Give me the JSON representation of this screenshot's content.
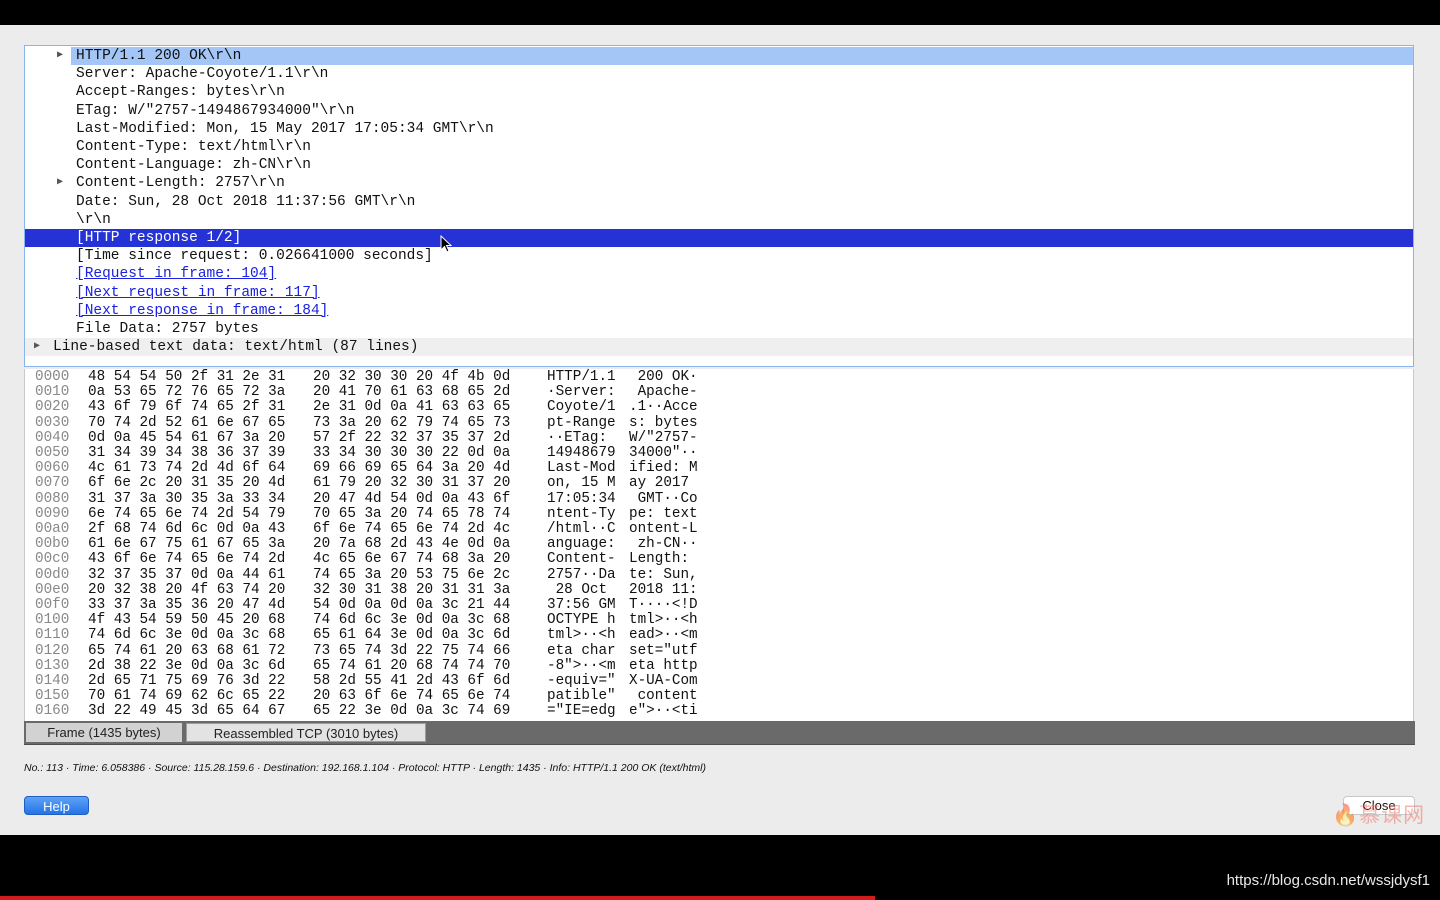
{
  "details": {
    "rows": [
      {
        "text": "HTTP/1.1 200 OK\\r\\n",
        "tri": "▶",
        "indent": 2,
        "state": "sel-light"
      },
      {
        "text": "Server: Apache-Coyote/1.1\\r\\n",
        "indent": 2
      },
      {
        "text": "Accept-Ranges: bytes\\r\\n",
        "indent": 2
      },
      {
        "text": "ETag: W/\"2757-1494867934000\"\\r\\n",
        "indent": 2
      },
      {
        "text": "Last-Modified: Mon, 15 May 2017 17:05:34 GMT\\r\\n",
        "indent": 2
      },
      {
        "text": "Content-Type: text/html\\r\\n",
        "indent": 2
      },
      {
        "text": "Content-Language: zh-CN\\r\\n",
        "indent": 2
      },
      {
        "text": "Content-Length: 2757\\r\\n",
        "tri": "▶",
        "indent": 2
      },
      {
        "text": "Date: Sun, 28 Oct 2018 11:37:56 GMT\\r\\n",
        "indent": 2
      },
      {
        "text": "\\r\\n",
        "indent": 2
      },
      {
        "text": "[HTTP response 1/2]",
        "indent": 2,
        "state": "sel-dark"
      },
      {
        "text": "[Time since request: 0.026641000 seconds]",
        "indent": 2
      },
      {
        "text": "[Request in frame: 104]",
        "indent": 2,
        "link": true
      },
      {
        "text": "[Next request in frame: 117]",
        "indent": 2,
        "link": true
      },
      {
        "text": "[Next response in frame: 184]",
        "indent": 2,
        "link": true
      },
      {
        "text": "File Data: 2757 bytes",
        "indent": 2
      },
      {
        "text": "Line-based text data: text/html (87 lines)",
        "tri": "▶",
        "indent": 1,
        "state": "last"
      }
    ]
  },
  "hex": {
    "rows": [
      {
        "off": "0000",
        "b1": "48 54 54 50 2f 31 2e 31",
        "b2": "20 32 30 30 20 4f 4b 0d",
        "a1": "HTTP/1.1",
        "a2": " 200 OK·"
      },
      {
        "off": "0010",
        "b1": "0a 53 65 72 76 65 72 3a",
        "b2": "20 41 70 61 63 68 65 2d",
        "a1": "·Server:",
        "a2": " Apache-"
      },
      {
        "off": "0020",
        "b1": "43 6f 79 6f 74 65 2f 31",
        "b2": "2e 31 0d 0a 41 63 63 65",
        "a1": "Coyote/1",
        "a2": ".1··Acce"
      },
      {
        "off": "0030",
        "b1": "70 74 2d 52 61 6e 67 65",
        "b2": "73 3a 20 62 79 74 65 73",
        "a1": "pt-Range",
        "a2": "s: bytes"
      },
      {
        "off": "0040",
        "b1": "0d 0a 45 54 61 67 3a 20",
        "b2": "57 2f 22 32 37 35 37 2d",
        "a1": "··ETag: ",
        "a2": "W/\"2757-"
      },
      {
        "off": "0050",
        "b1": "31 34 39 34 38 36 37 39",
        "b2": "33 34 30 30 30 22 0d 0a",
        "a1": "14948679",
        "a2": "34000\"··"
      },
      {
        "off": "0060",
        "b1": "4c 61 73 74 2d 4d 6f 64",
        "b2": "69 66 69 65 64 3a 20 4d",
        "a1": "Last-Mod",
        "a2": "ified: M"
      },
      {
        "off": "0070",
        "b1": "6f 6e 2c 20 31 35 20 4d",
        "b2": "61 79 20 32 30 31 37 20",
        "a1": "on, 15 M",
        "a2": "ay 2017 "
      },
      {
        "off": "0080",
        "b1": "31 37 3a 30 35 3a 33 34",
        "b2": "20 47 4d 54 0d 0a 43 6f",
        "a1": "17:05:34",
        "a2": " GMT··Co"
      },
      {
        "off": "0090",
        "b1": "6e 74 65 6e 74 2d 54 79",
        "b2": "70 65 3a 20 74 65 78 74",
        "a1": "ntent-Ty",
        "a2": "pe: text"
      },
      {
        "off": "00a0",
        "b1": "2f 68 74 6d 6c 0d 0a 43",
        "b2": "6f 6e 74 65 6e 74 2d 4c",
        "a1": "/html··C",
        "a2": "ontent-L"
      },
      {
        "off": "00b0",
        "b1": "61 6e 67 75 61 67 65 3a",
        "b2": "20 7a 68 2d 43 4e 0d 0a",
        "a1": "anguage:",
        "a2": " zh-CN··"
      },
      {
        "off": "00c0",
        "b1": "43 6f 6e 74 65 6e 74 2d",
        "b2": "4c 65 6e 67 74 68 3a 20",
        "a1": "Content-",
        "a2": "Length: "
      },
      {
        "off": "00d0",
        "b1": "32 37 35 37 0d 0a 44 61",
        "b2": "74 65 3a 20 53 75 6e 2c",
        "a1": "2757··Da",
        "a2": "te: Sun,"
      },
      {
        "off": "00e0",
        "b1": "20 32 38 20 4f 63 74 20",
        "b2": "32 30 31 38 20 31 31 3a",
        "a1": " 28 Oct ",
        "a2": "2018 11:"
      },
      {
        "off": "00f0",
        "b1": "33 37 3a 35 36 20 47 4d",
        "b2": "54 0d 0a 0d 0a 3c 21 44",
        "a1": "37:56 GM",
        "a2": "T····<!D"
      },
      {
        "off": "0100",
        "b1": "4f 43 54 59 50 45 20 68",
        "b2": "74 6d 6c 3e 0d 0a 3c 68",
        "a1": "OCTYPE h",
        "a2": "tml>··<h"
      },
      {
        "off": "0110",
        "b1": "74 6d 6c 3e 0d 0a 3c 68",
        "b2": "65 61 64 3e 0d 0a 3c 6d",
        "a1": "tml>··<h",
        "a2": "ead>··<m"
      },
      {
        "off": "0120",
        "b1": "65 74 61 20 63 68 61 72",
        "b2": "73 65 74 3d 22 75 74 66",
        "a1": "eta char",
        "a2": "set=\"utf"
      },
      {
        "off": "0130",
        "b1": "2d 38 22 3e 0d 0a 3c 6d",
        "b2": "65 74 61 20 68 74 74 70",
        "a1": "-8\">··<m",
        "a2": "eta http"
      },
      {
        "off": "0140",
        "b1": "2d 65 71 75 69 76 3d 22",
        "b2": "58 2d 55 41 2d 43 6f 6d",
        "a1": "-equiv=\"",
        "a2": "X-UA-Com"
      },
      {
        "off": "0150",
        "b1": "70 61 74 69 62 6c 65 22",
        "b2": "20 63 6f 6e 74 65 6e 74",
        "a1": "patible\"",
        "a2": " content"
      },
      {
        "off": "0160",
        "b1": "3d 22 49 45 3d 65 64 67",
        "b2": "65 22 3e 0d 0a 3c 74 69",
        "a1": "=\"IE=edg",
        "a2": "e\">··<ti"
      }
    ]
  },
  "tabs": {
    "frame": "Frame (1435 bytes)",
    "reassembled": "Reassembled TCP (3010 bytes)"
  },
  "status": "No.: 113 · Time: 6.058386 · Source: 115.28.159.6 · Destination: 192.168.1.104 · Protocol: HTTP · Length: 1435 · Info: HTTP/1.1 200 OK (text/html)",
  "buttons": {
    "help": "Help",
    "close": "Close"
  },
  "watermark": "慕课网",
  "footer_url": "https://blog.csdn.net/wssjdysf1",
  "colors": {
    "selection_light": "#a3c6f7",
    "selection_dark": "#2533d6",
    "link": "#1a22e0",
    "help_button": "#2f7eea"
  }
}
